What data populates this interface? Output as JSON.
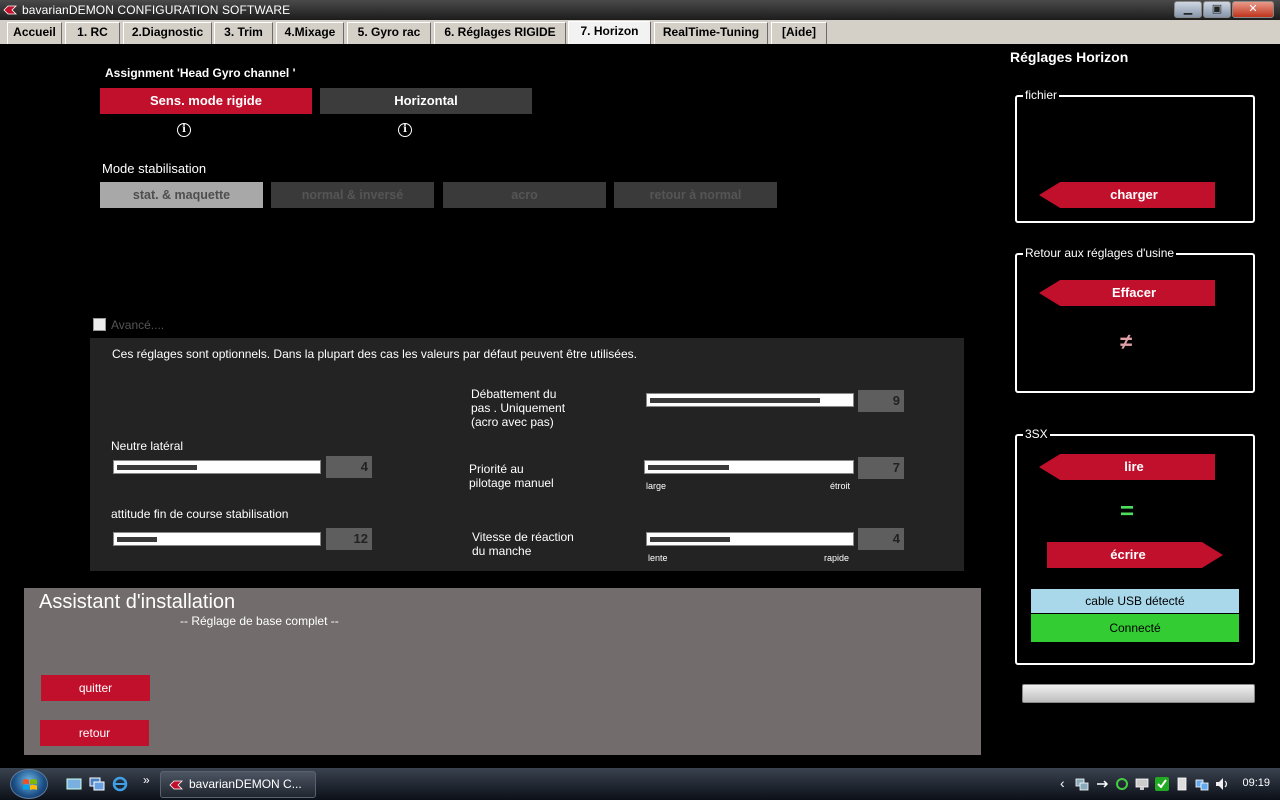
{
  "window": {
    "title": "bavarianDEMON CONFIGURATION SOFTWARE",
    "minimize_label": "▁",
    "maximize_label": "▣",
    "close_label": "✕"
  },
  "tabs": [
    {
      "label": "Accueil"
    },
    {
      "label": "1. RC"
    },
    {
      "label": "2.Diagnostic"
    },
    {
      "label": "3. Trim"
    },
    {
      "label": "4.Mixage"
    },
    {
      "label": "5. Gyro rac"
    },
    {
      "label": "6. Réglages RIGIDE"
    },
    {
      "label": "7. Horizon",
      "active": true
    },
    {
      "label": "RealTime-Tuning"
    },
    {
      "label": "[Aide]"
    }
  ],
  "assignment": {
    "heading": "Assignment 'Head Gyro channel '",
    "option_rigid": "Sens. mode rigide",
    "option_horizontal": "Horizontal",
    "info_glyph": "i"
  },
  "stabilisation": {
    "heading": "Mode stabilisation",
    "modes": [
      "stat. & maquette",
      "normal & inversé",
      "acro",
      "retour à normal"
    ],
    "selected": "stat. & maquette"
  },
  "advanced": {
    "checkbox_label": "Avancé....",
    "checked": false,
    "note": "Ces réglages sont optionnels. Dans la plupart des cas les valeurs par défaut peuvent être utilisées.",
    "neutre_lateral": {
      "label": "Neutre latéral",
      "value": "4",
      "level": 0.4
    },
    "attitude": {
      "label": "attitude fin de course stabilisation",
      "value": "12",
      "level": 0.2
    },
    "debattement": {
      "label_line1": "Débattement du",
      "label_line2": "pas . Uniquement",
      "label_line3": "(acro avec pas)",
      "value": "9",
      "level": 0.85
    },
    "priorite": {
      "label_line1": "Priorité au",
      "label_line2": "pilotage manuel",
      "value": "7",
      "level": 0.4,
      "min_label": "large",
      "max_label": "étroit"
    },
    "vitesse": {
      "label_line1": "Vitesse de réaction",
      "label_line2": "du manche",
      "value": "4",
      "level": 0.4,
      "min_label": "lente",
      "max_label": "rapide"
    }
  },
  "assistant": {
    "title": "Assistant d'installation",
    "subtitle": "-- Réglage de base complet --",
    "quit_label": "quitter",
    "back_label": "retour"
  },
  "side": {
    "heading": "Réglages Horizon",
    "file_group": {
      "legend": "fichier",
      "load_label": "charger"
    },
    "factory_group": {
      "legend": "Retour aux réglages d'usine",
      "erase_label": "Effacer",
      "status_glyph": "≠"
    },
    "device_group": {
      "legend": "3SX",
      "read_label": "lire",
      "status_glyph": "=",
      "write_label": "écrire"
    },
    "usb_status": "cable USB détecté",
    "connection_status": "Connecté",
    "colors": {
      "accent": "#c0102c",
      "usb": "#a8d8ea",
      "connected": "#33cc33"
    }
  },
  "taskbar": {
    "task_label": "bavarianDEMON C...",
    "clock": "09:19",
    "chevron": "»",
    "tray_arrow": "‹"
  }
}
